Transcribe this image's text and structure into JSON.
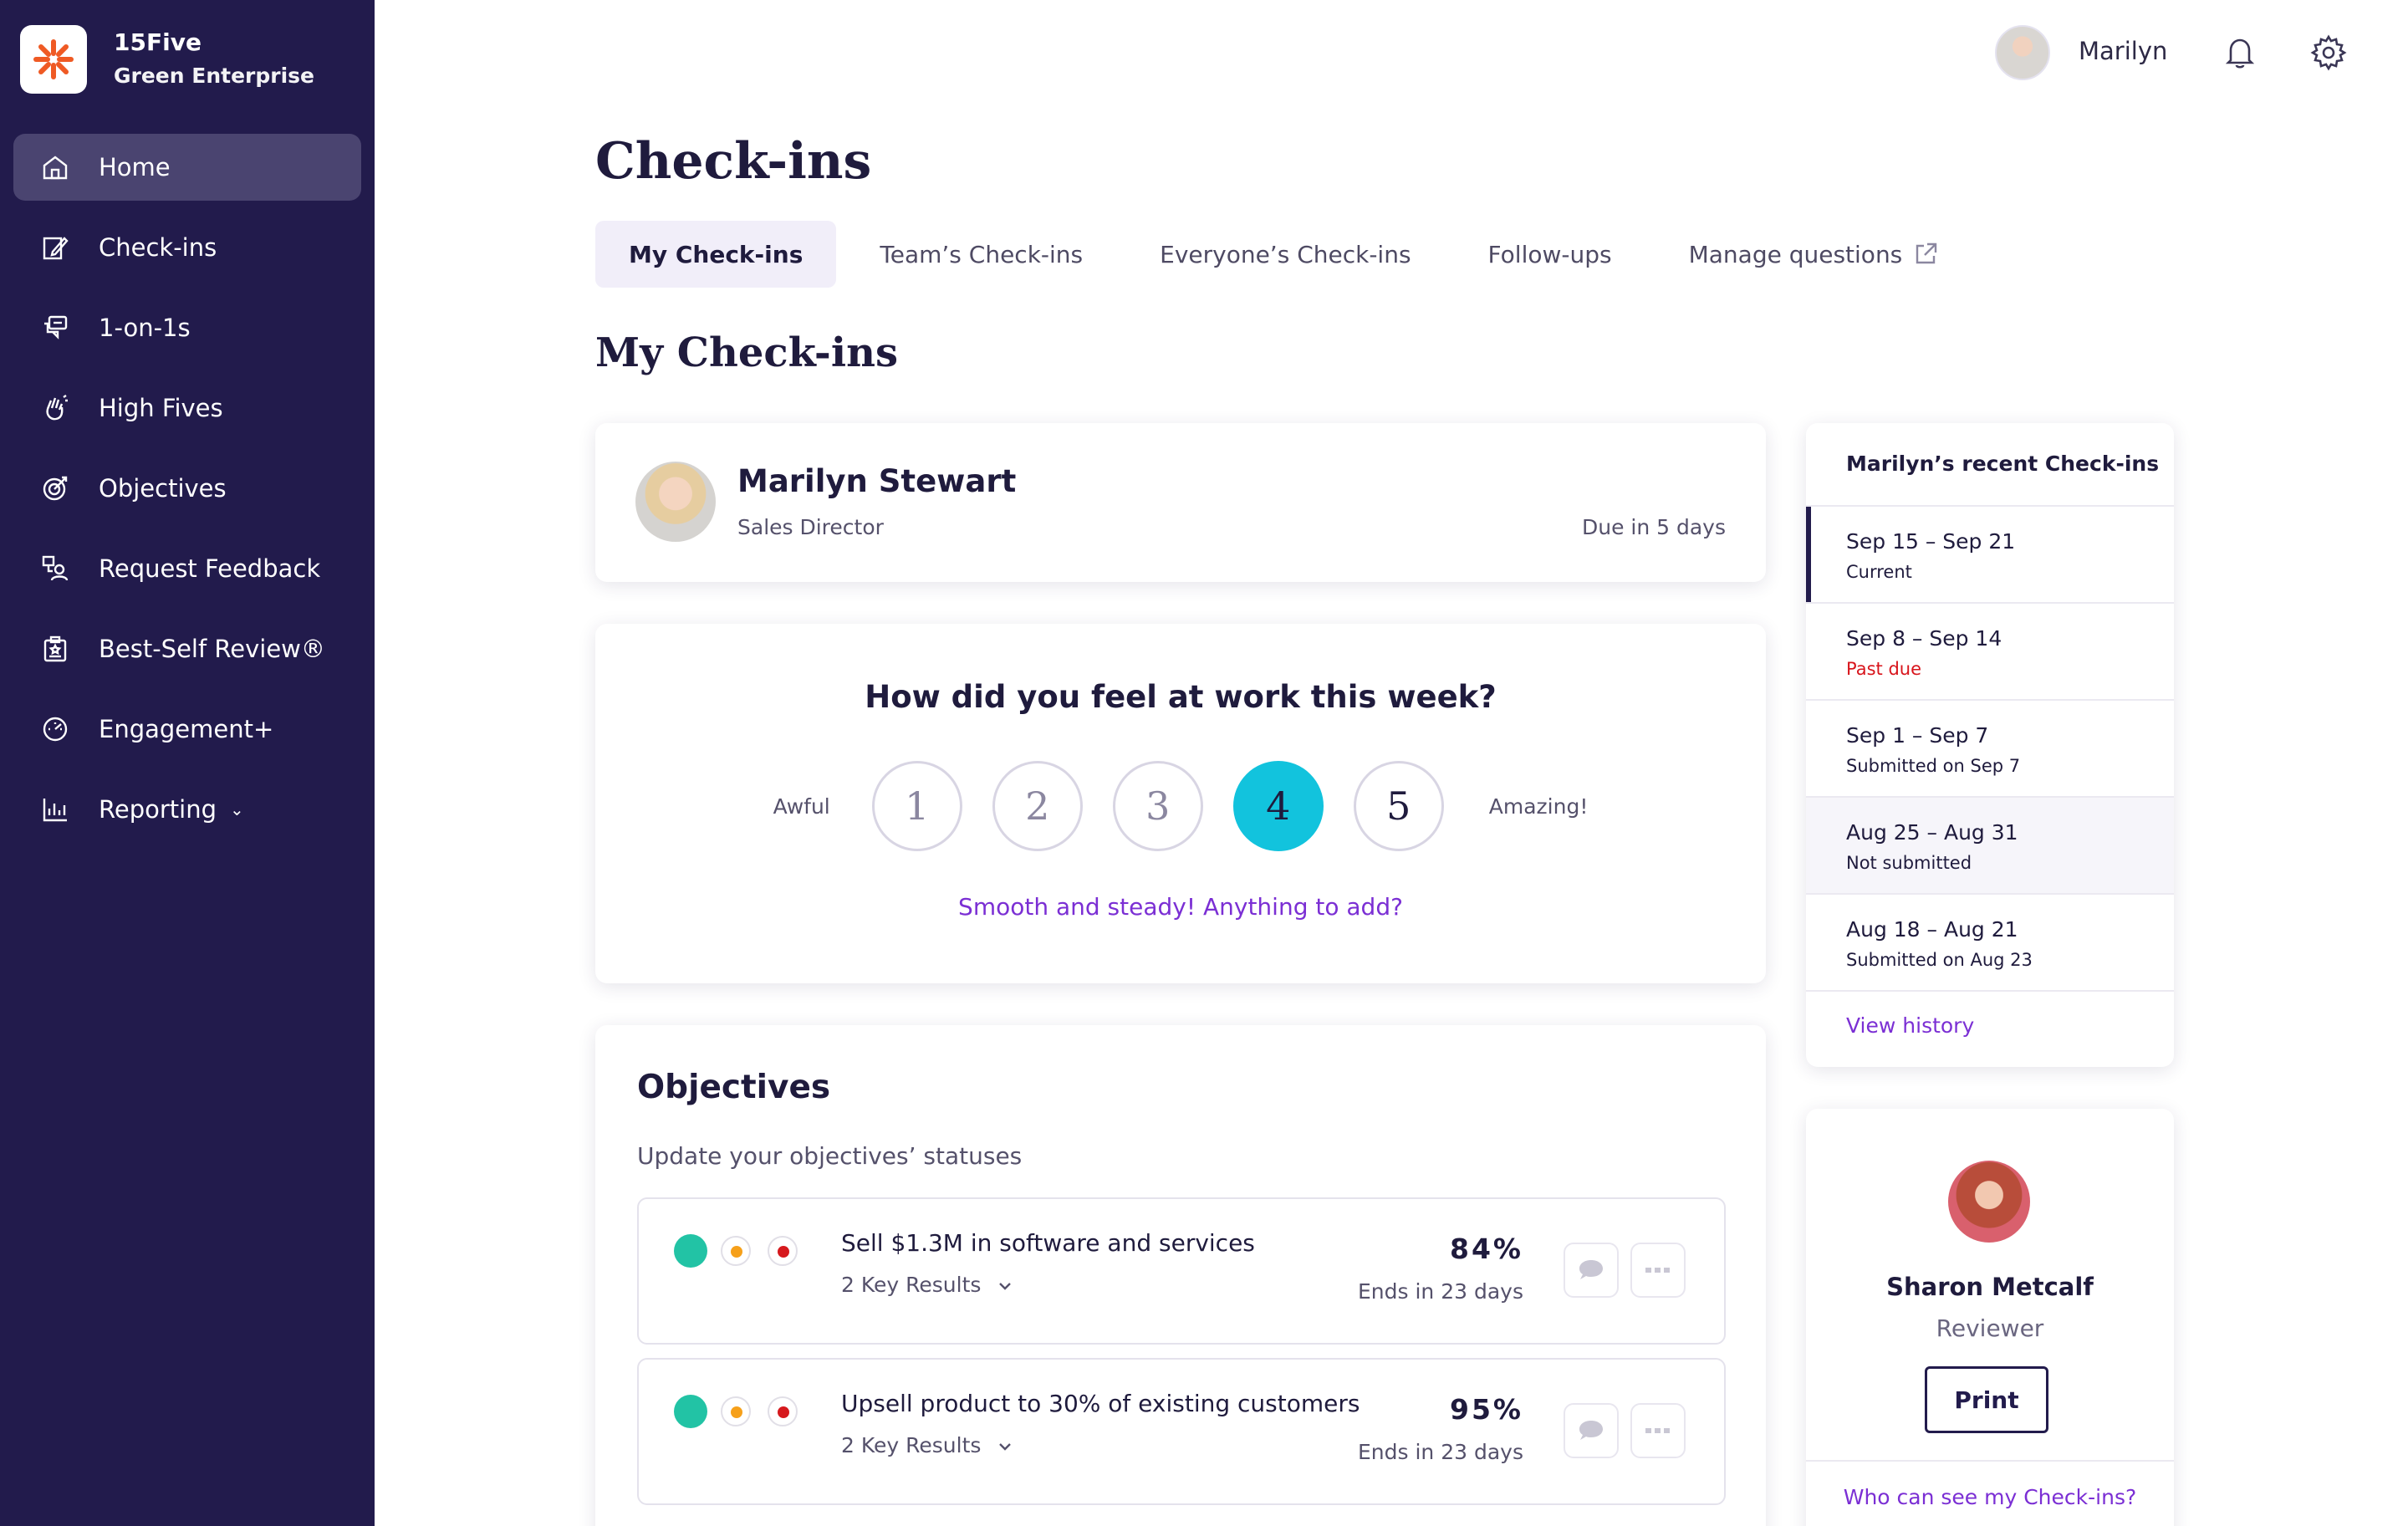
{
  "brand": {
    "name": "15Five",
    "org": "Green Enterprise"
  },
  "sidebar": {
    "items": [
      {
        "label": "Home",
        "icon": "home-icon"
      },
      {
        "label": "Check-ins",
        "icon": "edit-icon"
      },
      {
        "label": "1-on-1s",
        "icon": "chat-icon"
      },
      {
        "label": "High Fives",
        "icon": "hand-icon"
      },
      {
        "label": "Objectives",
        "icon": "target-icon"
      },
      {
        "label": "Request Feedback",
        "icon": "feedback-icon"
      },
      {
        "label": "Best-Self Review®",
        "icon": "clipboard-icon"
      },
      {
        "label": "Engagement+",
        "icon": "gauge-icon"
      },
      {
        "label": "Reporting",
        "icon": "bar-chart-icon"
      }
    ]
  },
  "topbar": {
    "user_name": "Marilyn"
  },
  "page": {
    "title": "Check-ins",
    "tabs": [
      {
        "label": "My Check-ins"
      },
      {
        "label": "Team’s Check-ins"
      },
      {
        "label": "Everyone’s Check-ins"
      },
      {
        "label": "Follow-ups"
      },
      {
        "label": "Manage questions"
      }
    ],
    "section_title": "My Check-ins"
  },
  "profile": {
    "name": "Marilyn Stewart",
    "role": "Sales Director",
    "due": "Due in 5 days"
  },
  "mood": {
    "question": "How did you feel at work this week?",
    "low_label": "Awful",
    "high_label": "Amazing!",
    "options": [
      "1",
      "2",
      "3",
      "4",
      "5"
    ],
    "selected": 4,
    "prompt": "Smooth and steady! Anything to add?"
  },
  "objectives": {
    "title": "Objectives",
    "subtitle": "Update your objectives’ statuses",
    "items": [
      {
        "name": "Sell $1.3M in software and services",
        "key_results": "2 Key Results",
        "percent": "84%",
        "ends": "Ends in 23 days"
      },
      {
        "name": "Upsell product to 30% of existing customers",
        "key_results": "2 Key Results",
        "percent": "95%",
        "ends": "Ends in 23 days"
      }
    ]
  },
  "recent": {
    "title": "Marilyn’s recent Check-ins",
    "items": [
      {
        "date": "Sep 15 – Sep 21",
        "status": "Current"
      },
      {
        "date": "Sep 8 – Sep 14",
        "status": "Past due"
      },
      {
        "date": "Sep 1 – Sep 7",
        "status": "Submitted on Sep 7"
      },
      {
        "date": "Aug 25 – Aug 31",
        "status": "Not submitted"
      },
      {
        "date": "Aug 18 – Aug 21",
        "status": "Submitted on Aug 23"
      }
    ],
    "view_history": "View history"
  },
  "reviewer": {
    "name": "Sharon Metcalf",
    "role": "Reviewer",
    "print_label": "Print",
    "visibility_link": "Who can see my Check-ins?"
  },
  "colors": {
    "sidebar_bg": "#221b4c",
    "accent_link": "#7b2fd4",
    "selected_mood": "#12c3dd",
    "status_green": "#22c3a5",
    "status_yellow": "#f6a01a",
    "status_red": "#d6191d",
    "past_due": "#d8141b"
  }
}
